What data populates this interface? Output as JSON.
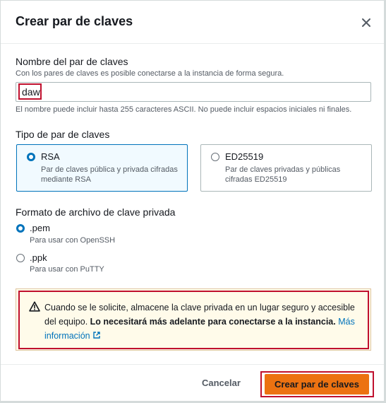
{
  "modal": {
    "title": "Crear par de claves"
  },
  "name_field": {
    "label": "Nombre del par de claves",
    "description": "Con los pares de claves es posible conectarse a la instancia de forma segura.",
    "value": "daw",
    "hint": "El nombre puede incluir hasta 255 caracteres ASCII. No puede incluir espacios iniciales ni finales."
  },
  "key_type": {
    "label": "Tipo de par de claves",
    "options": [
      {
        "label": "RSA",
        "description_line1": "Par de claves pública y privada cifradas",
        "description_line2": "mediante RSA",
        "selected": true
      },
      {
        "label": "ED25519",
        "description_line1": "Par de claves privadas y públicas",
        "description_line2": "cifradas ED25519",
        "selected": false
      }
    ]
  },
  "file_format": {
    "label": "Formato de archivo de clave privada",
    "options": [
      {
        "label": ".pem",
        "description": "Para usar con OpenSSH",
        "selected": true
      },
      {
        "label": ".ppk",
        "description": "Para usar con PuTTY",
        "selected": false
      }
    ]
  },
  "alert": {
    "text": "Cuando se le solicite, almacene la clave privada en un lugar seguro y accesible del equipo. ",
    "bold_text": "Lo necesitará más adelante para conectarse a la instancia.",
    "link_text": "Más información"
  },
  "footer": {
    "cancel_label": "Cancelar",
    "create_label": "Crear par de claves"
  },
  "colors": {
    "primary": "#ec7211",
    "link": "#0073bb",
    "highlight": "#c0102e",
    "warning_bg": "#fffbea"
  }
}
